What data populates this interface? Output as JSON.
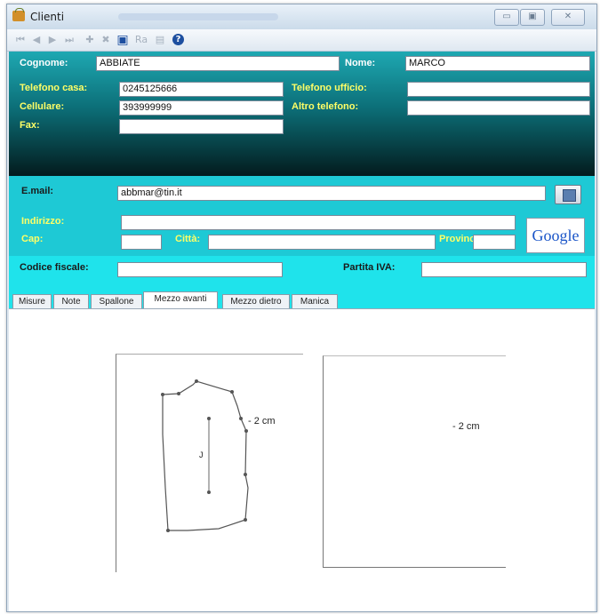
{
  "window": {
    "title": "Clienti"
  },
  "toolbar": {
    "first": "⏮",
    "prev": "◀",
    "next": "▶",
    "last": "⏭",
    "add": "✚",
    "delete": "✖",
    "save": "▣",
    "edit": "Ra",
    "print": "▤",
    "help": "?"
  },
  "form": {
    "cognome": {
      "label": "Cognome:",
      "value": "ABBIATE"
    },
    "nome": {
      "label": "Nome:",
      "value": "MARCO"
    },
    "telefono_casa": {
      "label": "Telefono casa:",
      "value": "0245125666"
    },
    "telefono_ufficio": {
      "label": "Telefono ufficio:",
      "value": ""
    },
    "cellulare": {
      "label": "Cellulare:",
      "value": "393999999"
    },
    "altro_telefono": {
      "label": "Altro telefono:",
      "value": ""
    },
    "fax": {
      "label": "Fax:",
      "value": ""
    },
    "email": {
      "label": "E.mail:",
      "value": "abbmar@tin.it"
    },
    "indirizzo": {
      "label": "Indirizzo:",
      "value": ""
    },
    "cap": {
      "label": "Cap:",
      "value": ""
    },
    "citta": {
      "label": "Città:",
      "value": ""
    },
    "provincia": {
      "label": "Provincia:",
      "value": ""
    },
    "codice_fiscale": {
      "label": "Codice fiscale:",
      "value": ""
    },
    "partita_iva": {
      "label": "Partita IVA:",
      "value": ""
    }
  },
  "google_button": "Google",
  "tabs": [
    "Misure",
    "Note",
    "Spallone",
    "Mezzo avanti",
    "Mezzo dietro",
    "Manica"
  ],
  "active_tab": "Mezzo avanti",
  "images": {
    "front": {
      "measure_label": "- 2 cm",
      "mark_label": "J"
    },
    "back": {
      "measure_label": "- 2 cm"
    }
  },
  "colors": {
    "header_top": "#1ea8b2",
    "header_bottom": "#031b1d",
    "cyan_panel": "#1ec9d5",
    "label_yellow": "#ffff66"
  }
}
